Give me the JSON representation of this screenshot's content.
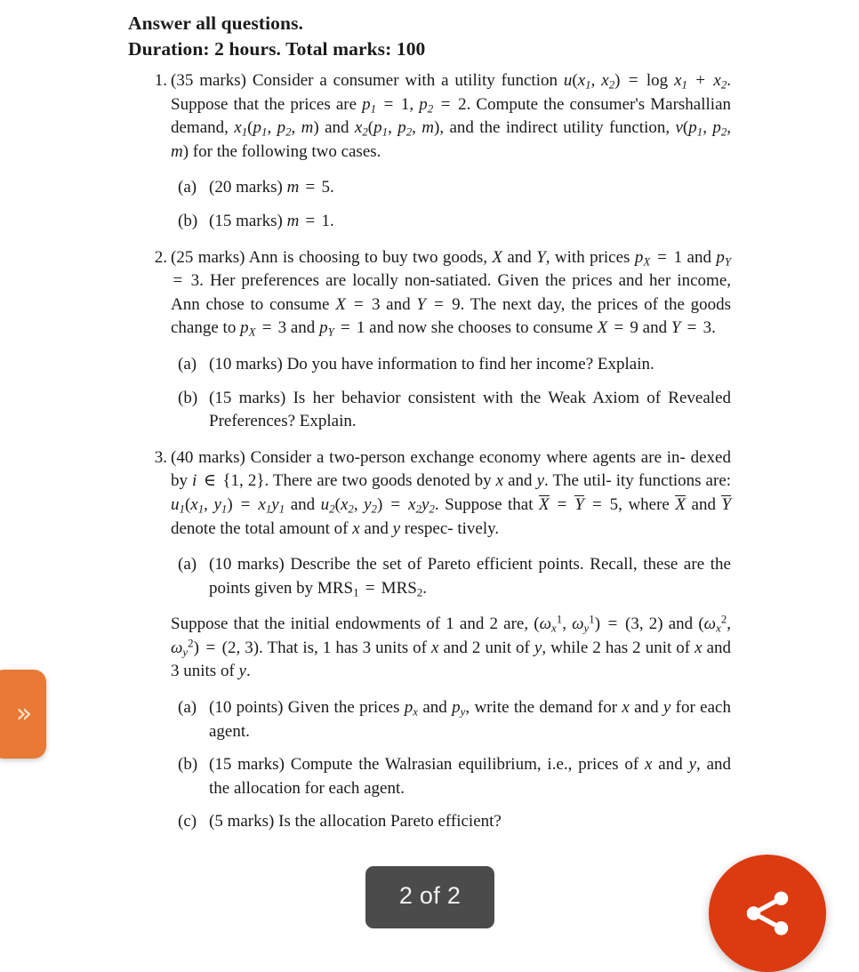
{
  "document": {
    "header_lines": [
      "Answer all questions.",
      "Duration: 2 hours. Total marks: 100"
    ],
    "questions": [
      {
        "number": "1.",
        "text": "(35 marks) Consider a consumer with a utility function u(x1, x2) = log x1 + x2. Suppose that the prices are p1 = 1, p2 = 2. Compute the consumer's Marshallian demand, x1(p1, p2, m) and x2(p1, p2, m), and the indirect utility function, v(p1, p2, m) for the following two cases.",
        "subitems": [
          {
            "mark": "(a)",
            "text": "(20 marks) m = 5."
          },
          {
            "mark": "(b)",
            "text": "(15 marks) m = 1."
          }
        ]
      },
      {
        "number": "2.",
        "text": "(25 marks) Ann is choosing to buy two goods, X and Y, with prices pX = 1 and pY = 3. Her preferences are locally non-satiated. Given the prices and her income, Ann chose to consume X = 3 and Y = 9. The next day, the prices of the goods change to pX = 3 and pY = 1 and now she chooses to consume X = 9 and Y = 3.",
        "subitems": [
          {
            "mark": "(a)",
            "text": "(10 marks) Do you have information to find her income? Explain."
          },
          {
            "mark": "(b)",
            "text": "(15 marks) Is her behavior consistent with the Weak Axiom of Revealed Preferences? Explain."
          }
        ]
      },
      {
        "number": "3.",
        "text": "(40 marks) Consider a two-person exchange economy where agents are indexed by i ∈ {1, 2}. There are two goods denoted by x and y. The utility functions are: u1(x1, y1) = x1y1 and u2(x2, y2) = x2y2. Suppose that X̄ = Ȳ = 5, where X̄ and Ȳ denote the total amount of x and y respectively.",
        "subitems": [
          {
            "mark": "(a)",
            "text": "(10 marks) Describe the set of Pareto efficient points. Recall, these are the points given by MRS1 = MRS2."
          }
        ],
        "interlude": "Suppose that the initial endowments of 1 and 2 are, (ω¹x, ω¹y) = (3, 2) and (ω²x, ω²y) = (2, 3). That is, 1 has 3 units of x and 2 unit of y, while 2 has 2 unit of x and 3 units of y.",
        "subitems2": [
          {
            "mark": "(a)",
            "text": "(10 points) Given the prices px and py, write the demand for x and y for each agent."
          },
          {
            "mark": "(b)",
            "text": "(15 marks) Compute the Walrasian equilibrium, i.e., prices of x and y, and the allocation for each agent."
          },
          {
            "mark": "(c)",
            "text": "(5 marks) Is the allocation Pareto efficient?"
          }
        ]
      }
    ]
  },
  "overlays": {
    "drawer_tab": {
      "icon": "double-chevron-right",
      "glyph": "»",
      "color": "#e87a35"
    },
    "page_indicator": {
      "label": "2 of 2",
      "color": "#4b4b4b"
    },
    "fab": {
      "icon": "share-icon",
      "color": "#dc3a10"
    }
  }
}
